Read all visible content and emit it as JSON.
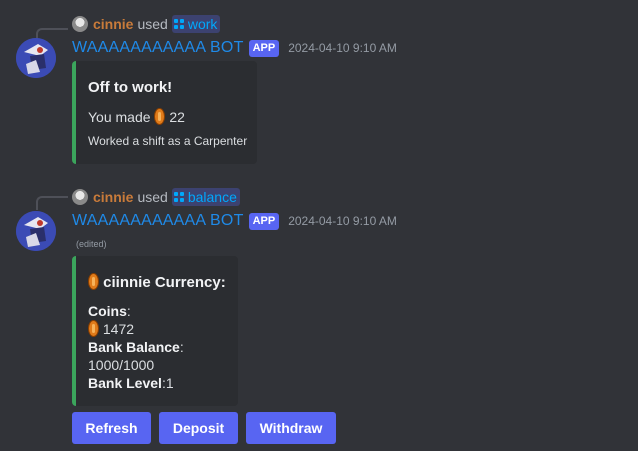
{
  "messages": [
    {
      "reply": {
        "user": "cinnie",
        "used": "used",
        "command": "work"
      },
      "bot_name": "WAAAAAAAAAAA BOT",
      "app_tag": "APP",
      "timestamp": "2024-04-10 9:10 AM",
      "embed": {
        "title": "Off to work!",
        "line_prefix": "You made",
        "amount": "22",
        "footer": "Worked a shift as a Carpenter"
      }
    },
    {
      "reply": {
        "user": "cinnie",
        "used": "used",
        "command": "balance"
      },
      "bot_name": "WAAAAAAAAAAA BOT",
      "app_tag": "APP",
      "timestamp": "2024-04-10 9:10 AM",
      "edited": "(edited)",
      "embed": {
        "title": "ciinnie Currency:",
        "coins_label": "Coins",
        "coins_value": "1472",
        "bank_balance_label": "Bank Balance",
        "bank_balance_value": "1000/1000",
        "bank_level_label": "Bank Level",
        "bank_level_value": "1",
        "colon": ":"
      },
      "buttons": [
        "Refresh",
        "Deposit",
        "Withdraw"
      ]
    }
  ],
  "colors": {
    "background": "#313338",
    "embed_bg": "#2b2d31",
    "embed_border": "#3ba55c",
    "bot_name": "#1f8ae8",
    "button": "#5865f2",
    "coin": "#e07b1a"
  }
}
